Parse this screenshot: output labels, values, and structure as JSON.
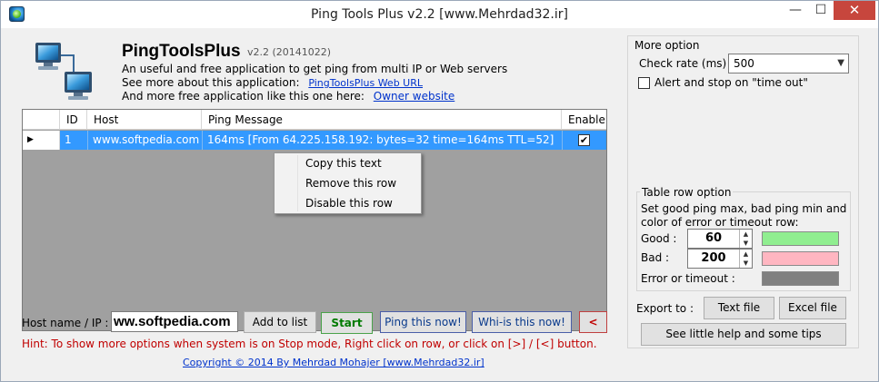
{
  "window": {
    "title": "Ping Tools Plus v2.2 [www.Mehrdad32.ir]",
    "minimize": "—",
    "maximize": "☐",
    "close": "✕"
  },
  "header": {
    "app_name": "PingToolsPlus",
    "version": "v2.2 (20141022)",
    "line1": "An useful and free application to get ping from multi IP or Web servers",
    "line2": "See more about this application:",
    "line2_link": "PingToolsPlus Web URL",
    "line3": "And more free application like this one here:",
    "line3_link": "Owner website"
  },
  "grid": {
    "columns": [
      "ID",
      "Host",
      "Ping Message",
      "Enable"
    ],
    "rows": [
      {
        "selector": "▶",
        "id": "1",
        "host": "www.softpedia.com",
        "message": "164ms [From 64.225.158.192: bytes=32 time=164ms TTL=52]",
        "enable_mark": "✔"
      }
    ]
  },
  "context_menu": {
    "items": [
      "Copy this text",
      "Remove this row",
      "Disable this row"
    ]
  },
  "host": {
    "label": "Host name / IP :",
    "value": "ww.softpedia.com"
  },
  "buttons": {
    "add": "Add to list",
    "start": "Start",
    "ping_now": "Ping this now!",
    "whois": "Whi-is this now!",
    "toggle": "<"
  },
  "hint": "Hint: To show more options when system is on Stop mode, Right click on row, or click on [>] / [<] button.",
  "copyright": "Copyright ©  2014 By Mehrdad Mohajer [www.Mehrdad32.ir]",
  "options": {
    "title": "More option",
    "check_rate_label": "Check rate (ms) :",
    "check_rate_value": "500",
    "alert_label": "Alert and stop on \"time out\"",
    "alert_checked": false
  },
  "table_row_option": {
    "title": "Table row option",
    "desc1": "Set good ping max, bad ping min and",
    "desc2": "color of error or timeout row:",
    "good_label": "Good :",
    "good_value": "60",
    "bad_label": "Bad :",
    "bad_value": "200",
    "error_label": "Error or timeout :",
    "colors": {
      "good": "#90ee90",
      "bad": "#ffb6c1",
      "error": "#808080"
    },
    "spin_up": "▲",
    "spin_down": "▼"
  },
  "export": {
    "label": "Export to :",
    "text_file": "Text file",
    "excel_file": "Excel file",
    "help": "See little help and some tips"
  }
}
